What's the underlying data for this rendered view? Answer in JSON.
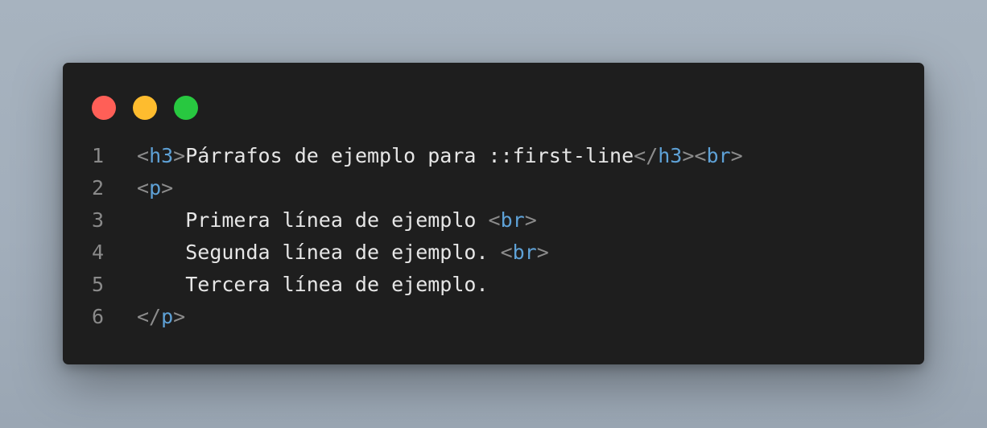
{
  "window": {
    "controls": {
      "close_color": "#ff5f57",
      "minimize_color": "#febc2e",
      "maximize_color": "#28c840"
    }
  },
  "code": {
    "lines": [
      {
        "number": "1",
        "indent": "",
        "segments": [
          {
            "kind": "punc",
            "text": "<"
          },
          {
            "kind": "tag",
            "text": "h3"
          },
          {
            "kind": "punc",
            "text": ">"
          },
          {
            "kind": "txt",
            "text": "Párrafos de ejemplo para ::first-line"
          },
          {
            "kind": "punc",
            "text": "</"
          },
          {
            "kind": "tag",
            "text": "h3"
          },
          {
            "kind": "punc",
            "text": "><"
          },
          {
            "kind": "tag",
            "text": "br"
          },
          {
            "kind": "punc",
            "text": ">"
          }
        ]
      },
      {
        "number": "2",
        "indent": "",
        "segments": [
          {
            "kind": "punc",
            "text": "<"
          },
          {
            "kind": "tag",
            "text": "p"
          },
          {
            "kind": "punc",
            "text": ">"
          }
        ]
      },
      {
        "number": "3",
        "indent": "    ",
        "segments": [
          {
            "kind": "txt",
            "text": "Primera línea de ejemplo "
          },
          {
            "kind": "punc",
            "text": "<"
          },
          {
            "kind": "tag",
            "text": "br"
          },
          {
            "kind": "punc",
            "text": ">"
          }
        ]
      },
      {
        "number": "4",
        "indent": "    ",
        "segments": [
          {
            "kind": "txt",
            "text": "Segunda línea de ejemplo. "
          },
          {
            "kind": "punc",
            "text": "<"
          },
          {
            "kind": "tag",
            "text": "br"
          },
          {
            "kind": "punc",
            "text": ">"
          }
        ]
      },
      {
        "number": "5",
        "indent": "    ",
        "segments": [
          {
            "kind": "txt",
            "text": "Tercera línea de ejemplo."
          }
        ]
      },
      {
        "number": "6",
        "indent": "",
        "segments": [
          {
            "kind": "punc",
            "text": "</"
          },
          {
            "kind": "tag",
            "text": "p"
          },
          {
            "kind": "punc",
            "text": ">"
          }
        ]
      }
    ]
  }
}
